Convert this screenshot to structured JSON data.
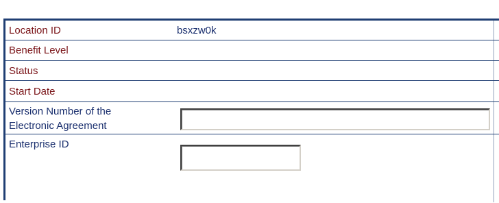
{
  "form": {
    "rows": [
      {
        "label": "Location ID",
        "value": "bsxzw0k"
      },
      {
        "label": "Benefit Level",
        "value": ""
      },
      {
        "label": "Status",
        "value": ""
      },
      {
        "label": "Start Date",
        "value": ""
      },
      {
        "label": "Version Number of the Electronic Agreement",
        "label_line1": "Version Number of the",
        "label_line2": "Electronic Agreement",
        "value": ""
      },
      {
        "label": "Enterprise ID",
        "value": ""
      }
    ]
  },
  "colors": {
    "border": "#1f3e73",
    "label_red": "#7a1418",
    "label_blue": "#1a2f6e"
  }
}
